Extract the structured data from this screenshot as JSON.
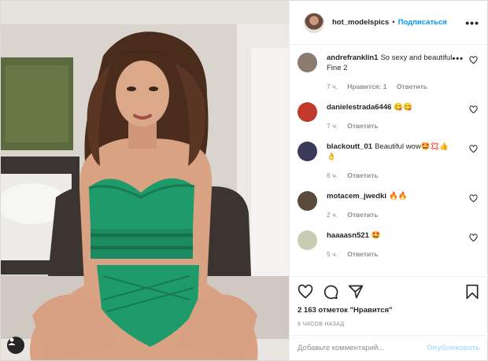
{
  "header": {
    "username": "hot_modelspics",
    "separator": "•",
    "follow_label": "Подписаться",
    "more_label": "•••"
  },
  "comments": [
    {
      "username": "andrefranklin1",
      "text": "So sexy and beautiful Fine 2",
      "time": "7 ч.",
      "likes": "Нравится: 1",
      "reply": "Ответить",
      "avatar_color": "#8a7a70",
      "more": "•••"
    },
    {
      "username": "danielestrada6446",
      "text": "😋😋",
      "time": "7 ч.",
      "reply": "Ответить",
      "avatar_color": "#c0392b"
    },
    {
      "username": "blackoutt_01",
      "text": "Beautiful wow🤩💢👍👌",
      "time": "6 ч.",
      "reply": "Ответить",
      "avatar_color": "#3a3a5a"
    },
    {
      "username": "motacem_jwedki",
      "text": "🔥🔥",
      "time": "2 ч.",
      "reply": "Ответить",
      "avatar_color": "#5a4a3a"
    },
    {
      "username": "haaaasn521",
      "text": "🤩",
      "time": "5 ч.",
      "reply": "Ответить",
      "avatar_color": "#c8ccb0"
    }
  ],
  "actions": {
    "likes_text": "2 163 отметок \"Нравится\"",
    "time_ago": "8 ЧАСОВ НАЗАД"
  },
  "add_comment": {
    "placeholder": "Добавьте комментарий...",
    "publish_label": "Опубликовать"
  },
  "icons": [
    "heart-icon",
    "comment-icon",
    "share-icon",
    "bookmark-icon",
    "user-tag-icon"
  ],
  "colors": {
    "accent": "#0095f6",
    "publish_disabled": "#b2dffc",
    "text": "#262626",
    "muted": "#8e8e8e",
    "outfit": "#1f9a6a"
  }
}
